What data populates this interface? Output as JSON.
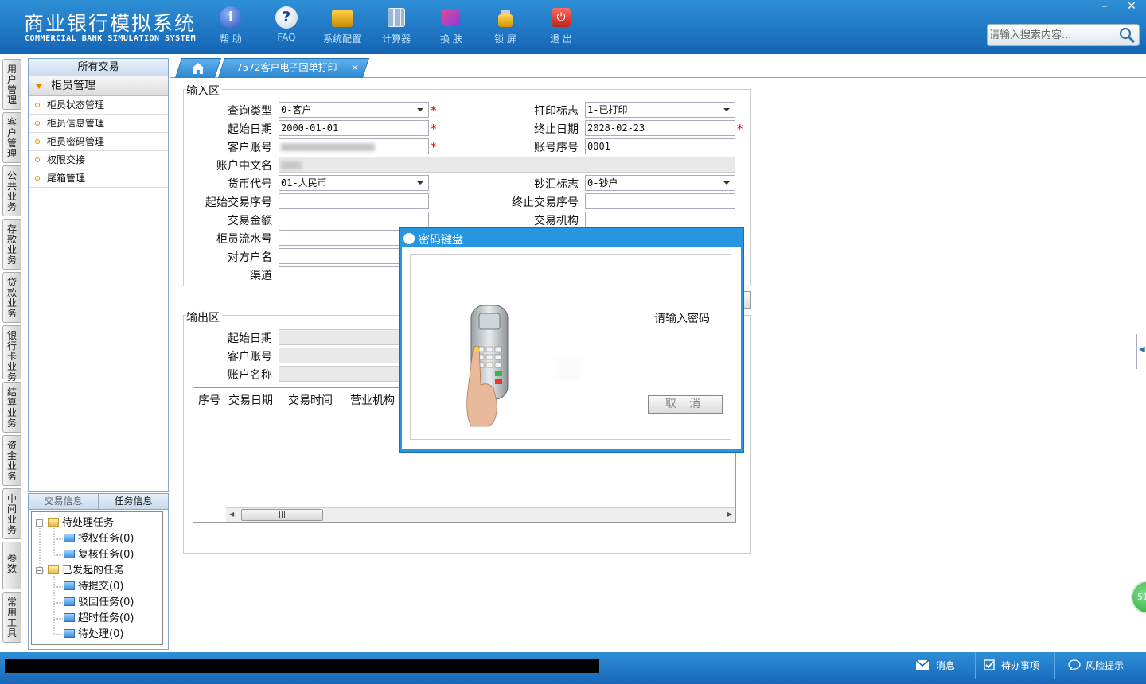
{
  "header": {
    "title_cn": "商业银行模拟系统",
    "title_en": "COMMERCIAL BANK SIMULATION SYSTEM",
    "tools": [
      {
        "label": "帮 助",
        "icon": "info-icon"
      },
      {
        "label": "FAQ",
        "icon": "question-icon"
      },
      {
        "label": "系统配置",
        "icon": "toolbox-icon"
      },
      {
        "label": "计算器",
        "icon": "calculator-icon"
      },
      {
        "label": "换 肤",
        "icon": "shirt-icon"
      },
      {
        "label": "锁 屏",
        "icon": "lock-icon"
      },
      {
        "label": "退 出",
        "icon": "power-icon"
      }
    ],
    "window_minimize": "–",
    "window_close": "✕",
    "search_placeholder": "请输入搜索内容..."
  },
  "left_nav": [
    "用户管理",
    "客户管理",
    "公共业务",
    "存款业务",
    "贷款业务",
    "银行卡业务",
    "结算业务",
    "资金业务",
    "中间业务",
    "参数",
    "常用工具"
  ],
  "menu": {
    "header": "所有交易",
    "group": "柜员管理",
    "items": [
      "柜员状态管理",
      "柜员信息管理",
      "柜员密码管理",
      "权限交接",
      "尾箱管理"
    ]
  },
  "task_panel": {
    "tabs": [
      "交易信息",
      "任务信息"
    ],
    "tree": {
      "pending": "待处理任务",
      "authorize": "授权任务(0)",
      "review": "复核任务(0)",
      "initiated": "已发起的任务",
      "to_submit": "待提交(0)",
      "rejected": "驳回任务(0)",
      "timeout": "超时任务(0)",
      "to_process": "待处理(0)"
    }
  },
  "tabs": {
    "active_label": "7572客户电子回单打印",
    "close": "×"
  },
  "input_zone": {
    "title": "输入区",
    "query_type_label": "查询类型",
    "query_type_value": "0-客户",
    "print_flag_label": "打印标志",
    "print_flag_value": "1-已打印",
    "start_date_label": "起始日期",
    "start_date_value": "2000-01-01",
    "end_date_label": "终止日期",
    "end_date_value": "2028-02-23",
    "account_label": "客户账号",
    "account_seq_label": "账号序号",
    "account_seq_value": "0001",
    "account_name_label": "账户中文名",
    "currency_label": "货币代号",
    "currency_value": "01-人民币",
    "cash_flag_label": "钞汇标志",
    "cash_flag_value": "0-钞户",
    "start_seq_label": "起始交易序号",
    "end_seq_label": "终止交易序号",
    "amount_label": "交易金额",
    "org_label": "交易机构",
    "teller_seq_label": "柜员流水号",
    "counterparty_label": "对方户名",
    "channel_label": "渠道"
  },
  "output_zone": {
    "title": "输出区",
    "start_date_label": "起始日期",
    "account_label": "客户账号",
    "account_name_label": "账户名称",
    "columns": [
      "序号",
      "交易日期",
      "交易时间",
      "营业机构"
    ]
  },
  "dialog": {
    "title": "密码键盘",
    "prompt": "请输入密码",
    "cancel": "取 消"
  },
  "footer": {
    "message": "消息",
    "todo": "待办事项",
    "risk": "风险提示"
  },
  "floating_badge": "51",
  "colors": {
    "header_blue": "#1f78c8",
    "required_red": "#dd0000",
    "dialog_blue": "#2696e0"
  }
}
